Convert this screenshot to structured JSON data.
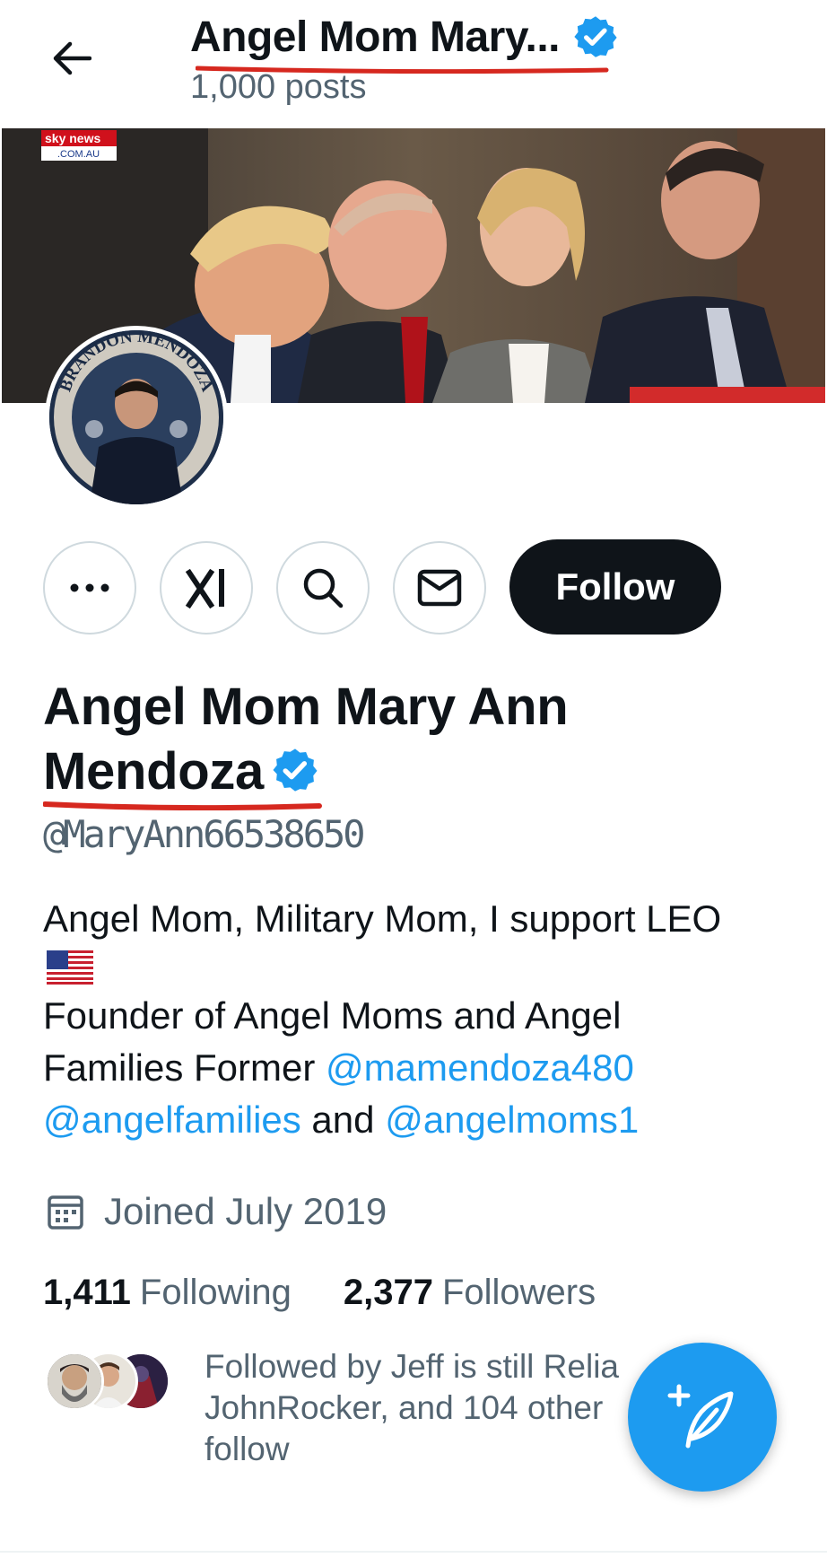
{
  "header": {
    "title": "Angel Mom Mary...",
    "posts": "1,000 posts"
  },
  "banner": {
    "logo_line1": "sky news",
    "logo_line2": ".COM.AU"
  },
  "avatar": {
    "badge_text": "BRANDON MENDOZA"
  },
  "actions": {
    "follow_label": "Follow"
  },
  "profile": {
    "name": "Angel Mom Mary Ann Mendoza",
    "handle": "@MaryAnn66538650",
    "bio_line1": "Angel Mom, Military Mom, I support LEO",
    "bio_line2a": "Founder of Angel Moms and Angel",
    "bio_line2b": "Families Former ",
    "mention1": "@mamendoza480",
    "mention2": "@angelfamilies",
    "bio_and": " and ",
    "mention3": "@angelmoms1",
    "joined": "Joined July 2019",
    "following_count": "1,411",
    "following_label": "Following",
    "followers_count": "2,377",
    "followers_label": "Followers"
  },
  "followed_by": {
    "line1": "Followed by Jeff is still Relia",
    "line2": "JohnRocker, and 104 other",
    "line3": "follow"
  },
  "colors": {
    "accent": "#1d9bf0",
    "text_primary": "#0f1419",
    "text_secondary": "#536471",
    "annotation_red": "#d6281f"
  },
  "icons": [
    "back-arrow-icon",
    "verified-badge-icon",
    "more-icon",
    "grok-icon",
    "search-icon",
    "message-icon",
    "calendar-icon",
    "compose-post-icon",
    "us-flag-icon"
  ]
}
